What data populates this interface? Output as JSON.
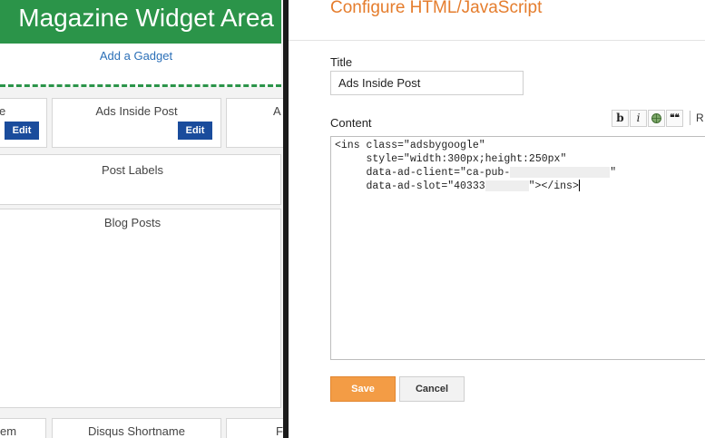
{
  "layout_panel": {
    "section_title": "Magazine Widget Area",
    "add_gadget_label": "Add a Gadget",
    "gadgets_row1": [
      {
        "label": "e",
        "edit_label": "Edit"
      },
      {
        "label": "Ads Inside Post",
        "edit_label": "Edit"
      },
      {
        "label": "A"
      }
    ],
    "post_labels": "Post Labels",
    "blog_posts": "Blog Posts",
    "gadgets_bottom": [
      "em",
      "Disqus Shortname",
      "F"
    ]
  },
  "dialog": {
    "heading": "Configure HTML/JavaScript",
    "title_label": "Title",
    "title_value": "Ads Inside Post",
    "content_label": "Content",
    "toolbar": {
      "bold": "b",
      "italic": "i",
      "link_icon": "link-icon",
      "quote": "❝❝",
      "more": "R"
    },
    "code": {
      "line1": "<ins class=\"adsbygoogle\"",
      "line2": "     style=\"width:300px;height:250px\"",
      "line3_prefix": "     data-ad-client=\"ca-pub-",
      "line3_suffix": "\"",
      "line4_prefix": "     data-ad-slot=\"40333",
      "line4_suffix": "\"></ins>"
    },
    "save_label": "Save",
    "cancel_label": "Cancel"
  },
  "colors": {
    "widget_green": "#2b9449",
    "heading_orange": "#e57d2d",
    "save_orange": "#f39c45",
    "edit_blue": "#1a4c9c",
    "link_blue": "#2b6fb7"
  }
}
